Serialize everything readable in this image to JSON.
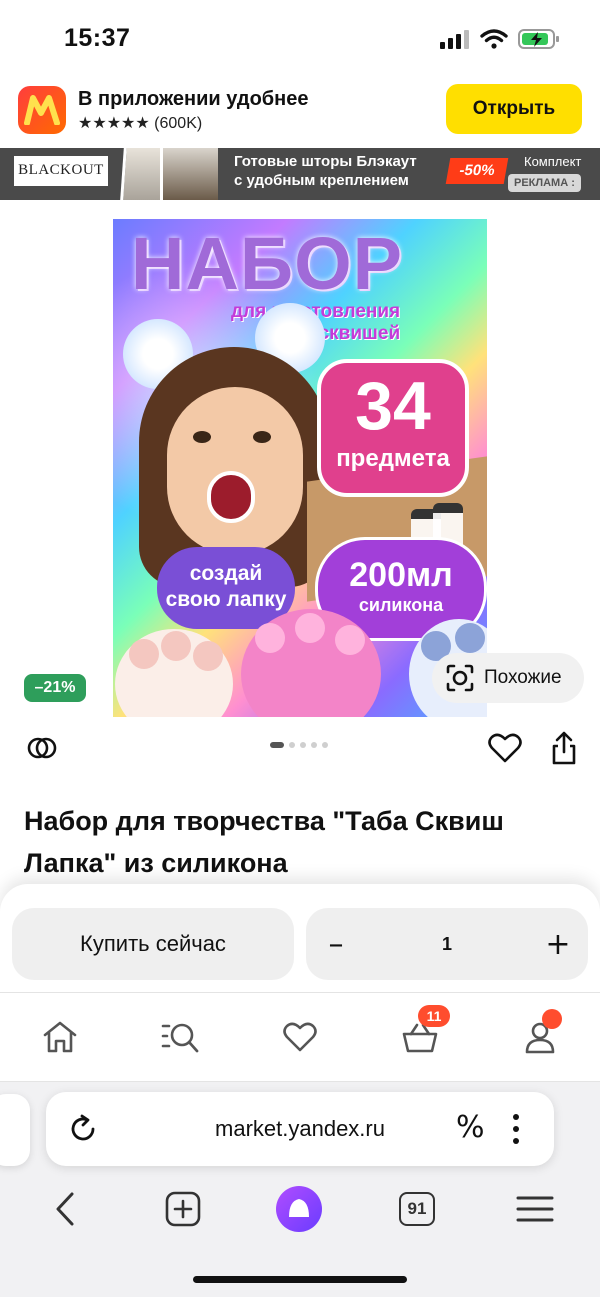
{
  "status_bar": {
    "time": "15:37"
  },
  "app_banner": {
    "title": "В приложении удобнее",
    "rating": "★★★★★ (600K)",
    "open_label": "Открыть",
    "accent": "#ffdf00"
  },
  "ad_banner": {
    "brand": "BLACKOUT",
    "line1": "Готовые шторы Блэкаут",
    "line2": "с удобным креплением",
    "sale": "-50%",
    "kit": "Комплект",
    "label": "РЕКЛАМА :"
  },
  "product_image": {
    "title": "НАБОР",
    "subtitle_line1": "для изготовления",
    "subtitle_line2": "сквишей",
    "count": "34",
    "count_label": "предмета",
    "create_line1": "создай",
    "create_line2": "свою лапку",
    "volume": "200мл",
    "volume_label": "силикона"
  },
  "discount": "–21%",
  "similar_label": "Похожие",
  "carousel": {
    "pages": 5,
    "active": 0
  },
  "product_title": "Набор для творчества \"Таба Сквиш Лапка\" из силикона",
  "buy": {
    "buy_now": "Купить сейчас",
    "quantity": "1",
    "minus": "–",
    "plus": "+"
  },
  "tabbar": {
    "cart_badge": "11",
    "accent": "#ff4d2e"
  },
  "browser": {
    "url": "market.yandex.ru",
    "percent": "%",
    "tabs_count": "91"
  }
}
